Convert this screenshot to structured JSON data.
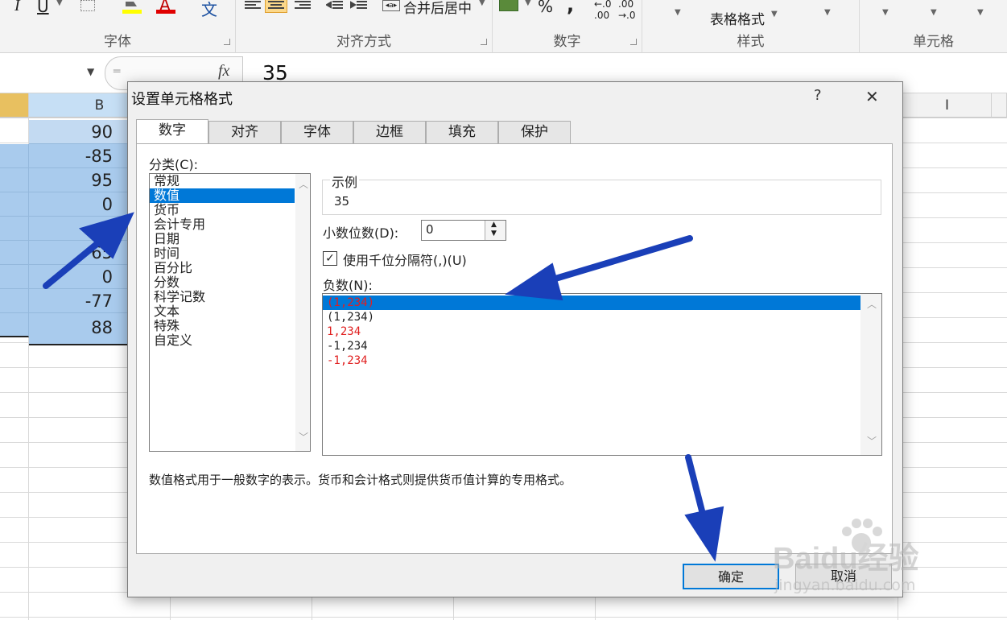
{
  "ribbon": {
    "groups": [
      {
        "label": "字体"
      },
      {
        "label": "对齐方式"
      },
      {
        "label": "数字"
      },
      {
        "label": "样式"
      },
      {
        "label": "单元格"
      }
    ],
    "italic_label": "I",
    "underline_label": "U",
    "font_color_label": "A",
    "wen_label": "文",
    "merge_center_label": "合并后居中",
    "percent_label": "%",
    "comma_label": ",",
    "table_format_label": "表格格式"
  },
  "formula_bar": {
    "fx_label": "fx",
    "value": "35"
  },
  "columns": {
    "b": "B",
    "i": "I"
  },
  "cells": [
    "90",
    "-85",
    "95",
    "0",
    "",
    "65",
    "0",
    "-77",
    "88"
  ],
  "dialog": {
    "title": "设置单元格格式",
    "help": "?",
    "close": "✕",
    "tabs": [
      {
        "label": "数字"
      },
      {
        "label": "对齐"
      },
      {
        "label": "字体"
      },
      {
        "label": "边框"
      },
      {
        "label": "填充"
      },
      {
        "label": "保护"
      }
    ],
    "category_label": "分类(C):",
    "categories": [
      "常规",
      "数值",
      "货币",
      "会计专用",
      "日期",
      "时间",
      "百分比",
      "分数",
      "科学记数",
      "文本",
      "特殊",
      "自定义"
    ],
    "sample_label": "示例",
    "sample_value": "35",
    "decimal_label": "小数位数(D):",
    "decimal_value": "0",
    "thousands_label": "使用千位分隔符(,)(U)",
    "thousands_checked": true,
    "negative_label": "负数(N):",
    "negatives": [
      {
        "text": "(1,234)",
        "color": "#e02020"
      },
      {
        "text": "(1,234)",
        "color": "#222222"
      },
      {
        "text": "1,234",
        "color": "#e02020"
      },
      {
        "text": "-1,234",
        "color": "#222222"
      },
      {
        "text": "-1,234",
        "color": "#e02020"
      }
    ],
    "description": "数值格式用于一般数字的表示。货币和会计格式则提供货币值计算的专用格式。",
    "ok": "确定",
    "cancel": "取消"
  },
  "watermark": {
    "brand": "Baidu经验",
    "url": "jingyan.baidu.com"
  },
  "colors": {
    "accent": "#0078d7",
    "selection": "#a9cbed",
    "arrow": "#1a3fb8"
  }
}
